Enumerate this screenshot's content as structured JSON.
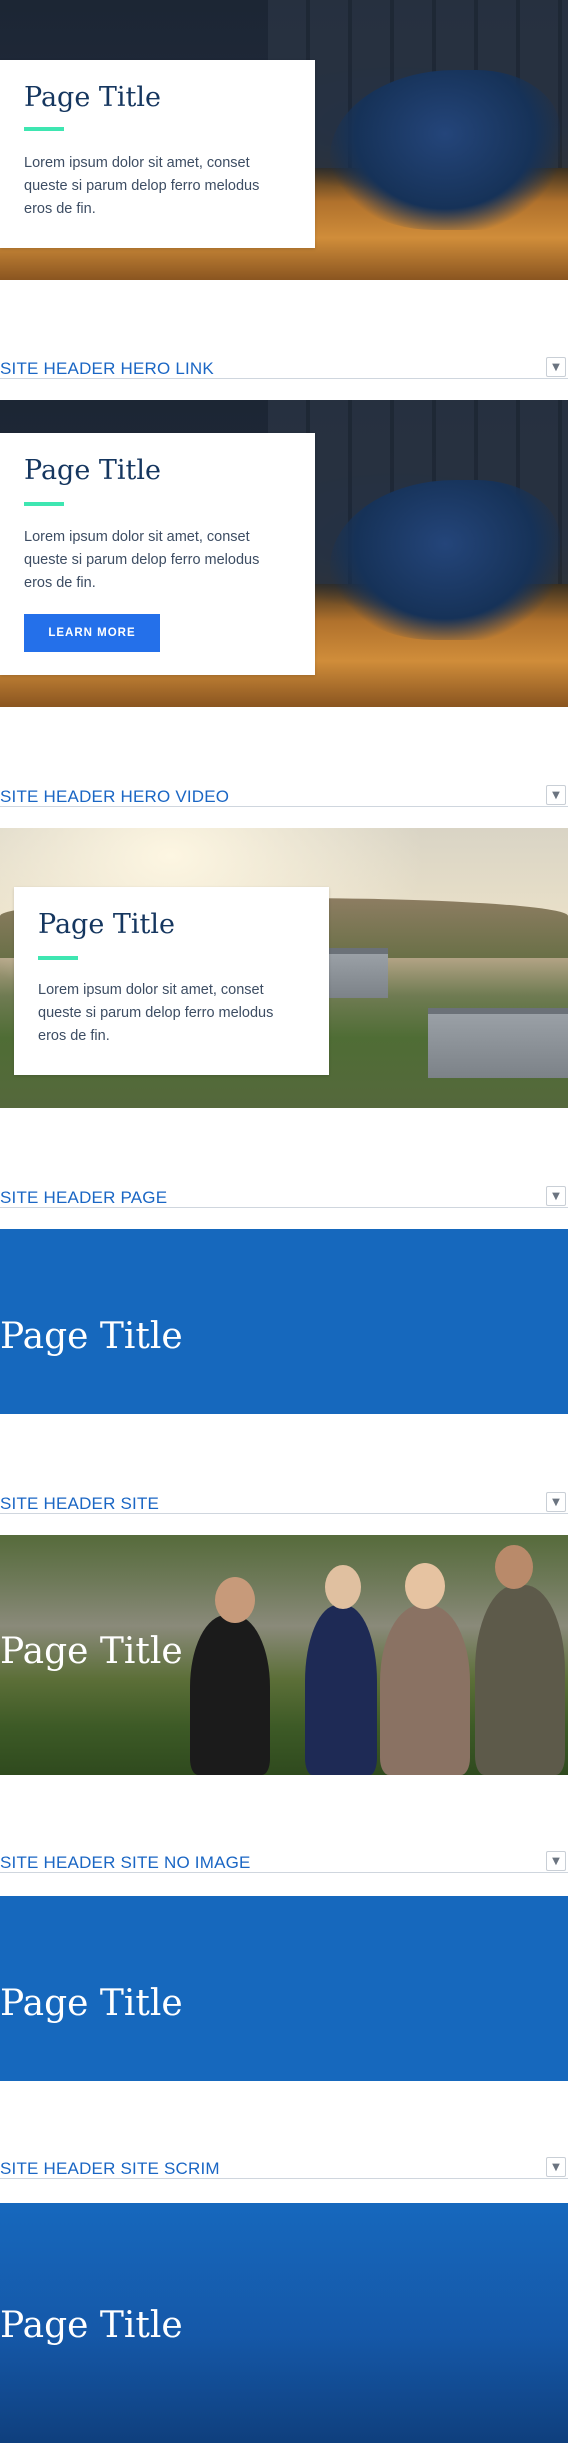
{
  "sections": {
    "hero": {
      "title": "Page Title",
      "body": "Lorem ipsum dolor sit amet, conset queste si parum delop ferro melodus eros de fin."
    },
    "hero_link": {
      "header": "SITE HEADER HERO LINK",
      "title": "Page Title",
      "body": "Lorem ipsum dolor sit amet, conset queste si parum delop ferro melodus eros de fin.",
      "button": "LEARN MORE"
    },
    "hero_video": {
      "header": "SITE HEADER HERO VIDEO",
      "title": "Page Title",
      "body": "Lorem ipsum dolor sit amet, conset queste si parum delop ferro melodus eros de fin."
    },
    "page": {
      "header": "SITE HEADER PAGE",
      "title": "Page Title"
    },
    "site": {
      "header": "SITE HEADER SITE",
      "title": "Page Title"
    },
    "site_no_image": {
      "header": "SITE HEADER SITE NO IMAGE",
      "title": "Page Title"
    },
    "site_scrim": {
      "header": "SITE HEADER SITE SCRIM",
      "title": "Page Title"
    }
  },
  "icons": {
    "toggle": "chevron-down-icon",
    "toggle_glyph": "▼"
  },
  "colors": {
    "header_text": "#1a66c4",
    "accent_rule": "#3ee6b1",
    "button_bg": "#2470ea",
    "banner_blue": "#1668bd",
    "title_navy": "#15365f"
  }
}
